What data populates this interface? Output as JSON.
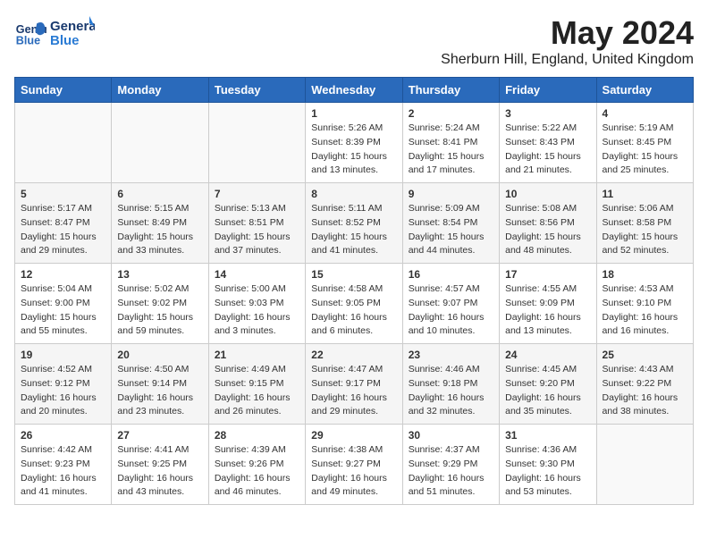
{
  "logo": {
    "line1": "General",
    "line2": "Blue"
  },
  "title": "May 2024",
  "location": "Sherburn Hill, England, United Kingdom",
  "days_of_week": [
    "Sunday",
    "Monday",
    "Tuesday",
    "Wednesday",
    "Thursday",
    "Friday",
    "Saturday"
  ],
  "weeks": [
    [
      {
        "day": "",
        "sunrise": "",
        "sunset": "",
        "daylight": ""
      },
      {
        "day": "",
        "sunrise": "",
        "sunset": "",
        "daylight": ""
      },
      {
        "day": "",
        "sunrise": "",
        "sunset": "",
        "daylight": ""
      },
      {
        "day": "1",
        "sunrise": "Sunrise: 5:26 AM",
        "sunset": "Sunset: 8:39 PM",
        "daylight": "Daylight: 15 hours and 13 minutes."
      },
      {
        "day": "2",
        "sunrise": "Sunrise: 5:24 AM",
        "sunset": "Sunset: 8:41 PM",
        "daylight": "Daylight: 15 hours and 17 minutes."
      },
      {
        "day": "3",
        "sunrise": "Sunrise: 5:22 AM",
        "sunset": "Sunset: 8:43 PM",
        "daylight": "Daylight: 15 hours and 21 minutes."
      },
      {
        "day": "4",
        "sunrise": "Sunrise: 5:19 AM",
        "sunset": "Sunset: 8:45 PM",
        "daylight": "Daylight: 15 hours and 25 minutes."
      }
    ],
    [
      {
        "day": "5",
        "sunrise": "Sunrise: 5:17 AM",
        "sunset": "Sunset: 8:47 PM",
        "daylight": "Daylight: 15 hours and 29 minutes."
      },
      {
        "day": "6",
        "sunrise": "Sunrise: 5:15 AM",
        "sunset": "Sunset: 8:49 PM",
        "daylight": "Daylight: 15 hours and 33 minutes."
      },
      {
        "day": "7",
        "sunrise": "Sunrise: 5:13 AM",
        "sunset": "Sunset: 8:51 PM",
        "daylight": "Daylight: 15 hours and 37 minutes."
      },
      {
        "day": "8",
        "sunrise": "Sunrise: 5:11 AM",
        "sunset": "Sunset: 8:52 PM",
        "daylight": "Daylight: 15 hours and 41 minutes."
      },
      {
        "day": "9",
        "sunrise": "Sunrise: 5:09 AM",
        "sunset": "Sunset: 8:54 PM",
        "daylight": "Daylight: 15 hours and 44 minutes."
      },
      {
        "day": "10",
        "sunrise": "Sunrise: 5:08 AM",
        "sunset": "Sunset: 8:56 PM",
        "daylight": "Daylight: 15 hours and 48 minutes."
      },
      {
        "day": "11",
        "sunrise": "Sunrise: 5:06 AM",
        "sunset": "Sunset: 8:58 PM",
        "daylight": "Daylight: 15 hours and 52 minutes."
      }
    ],
    [
      {
        "day": "12",
        "sunrise": "Sunrise: 5:04 AM",
        "sunset": "Sunset: 9:00 PM",
        "daylight": "Daylight: 15 hours and 55 minutes."
      },
      {
        "day": "13",
        "sunrise": "Sunrise: 5:02 AM",
        "sunset": "Sunset: 9:02 PM",
        "daylight": "Daylight: 15 hours and 59 minutes."
      },
      {
        "day": "14",
        "sunrise": "Sunrise: 5:00 AM",
        "sunset": "Sunset: 9:03 PM",
        "daylight": "Daylight: 16 hours and 3 minutes."
      },
      {
        "day": "15",
        "sunrise": "Sunrise: 4:58 AM",
        "sunset": "Sunset: 9:05 PM",
        "daylight": "Daylight: 16 hours and 6 minutes."
      },
      {
        "day": "16",
        "sunrise": "Sunrise: 4:57 AM",
        "sunset": "Sunset: 9:07 PM",
        "daylight": "Daylight: 16 hours and 10 minutes."
      },
      {
        "day": "17",
        "sunrise": "Sunrise: 4:55 AM",
        "sunset": "Sunset: 9:09 PM",
        "daylight": "Daylight: 16 hours and 13 minutes."
      },
      {
        "day": "18",
        "sunrise": "Sunrise: 4:53 AM",
        "sunset": "Sunset: 9:10 PM",
        "daylight": "Daylight: 16 hours and 16 minutes."
      }
    ],
    [
      {
        "day": "19",
        "sunrise": "Sunrise: 4:52 AM",
        "sunset": "Sunset: 9:12 PM",
        "daylight": "Daylight: 16 hours and 20 minutes."
      },
      {
        "day": "20",
        "sunrise": "Sunrise: 4:50 AM",
        "sunset": "Sunset: 9:14 PM",
        "daylight": "Daylight: 16 hours and 23 minutes."
      },
      {
        "day": "21",
        "sunrise": "Sunrise: 4:49 AM",
        "sunset": "Sunset: 9:15 PM",
        "daylight": "Daylight: 16 hours and 26 minutes."
      },
      {
        "day": "22",
        "sunrise": "Sunrise: 4:47 AM",
        "sunset": "Sunset: 9:17 PM",
        "daylight": "Daylight: 16 hours and 29 minutes."
      },
      {
        "day": "23",
        "sunrise": "Sunrise: 4:46 AM",
        "sunset": "Sunset: 9:18 PM",
        "daylight": "Daylight: 16 hours and 32 minutes."
      },
      {
        "day": "24",
        "sunrise": "Sunrise: 4:45 AM",
        "sunset": "Sunset: 9:20 PM",
        "daylight": "Daylight: 16 hours and 35 minutes."
      },
      {
        "day": "25",
        "sunrise": "Sunrise: 4:43 AM",
        "sunset": "Sunset: 9:22 PM",
        "daylight": "Daylight: 16 hours and 38 minutes."
      }
    ],
    [
      {
        "day": "26",
        "sunrise": "Sunrise: 4:42 AM",
        "sunset": "Sunset: 9:23 PM",
        "daylight": "Daylight: 16 hours and 41 minutes."
      },
      {
        "day": "27",
        "sunrise": "Sunrise: 4:41 AM",
        "sunset": "Sunset: 9:25 PM",
        "daylight": "Daylight: 16 hours and 43 minutes."
      },
      {
        "day": "28",
        "sunrise": "Sunrise: 4:39 AM",
        "sunset": "Sunset: 9:26 PM",
        "daylight": "Daylight: 16 hours and 46 minutes."
      },
      {
        "day": "29",
        "sunrise": "Sunrise: 4:38 AM",
        "sunset": "Sunset: 9:27 PM",
        "daylight": "Daylight: 16 hours and 49 minutes."
      },
      {
        "day": "30",
        "sunrise": "Sunrise: 4:37 AM",
        "sunset": "Sunset: 9:29 PM",
        "daylight": "Daylight: 16 hours and 51 minutes."
      },
      {
        "day": "31",
        "sunrise": "Sunrise: 4:36 AM",
        "sunset": "Sunset: 9:30 PM",
        "daylight": "Daylight: 16 hours and 53 minutes."
      },
      {
        "day": "",
        "sunrise": "",
        "sunset": "",
        "daylight": ""
      }
    ]
  ]
}
